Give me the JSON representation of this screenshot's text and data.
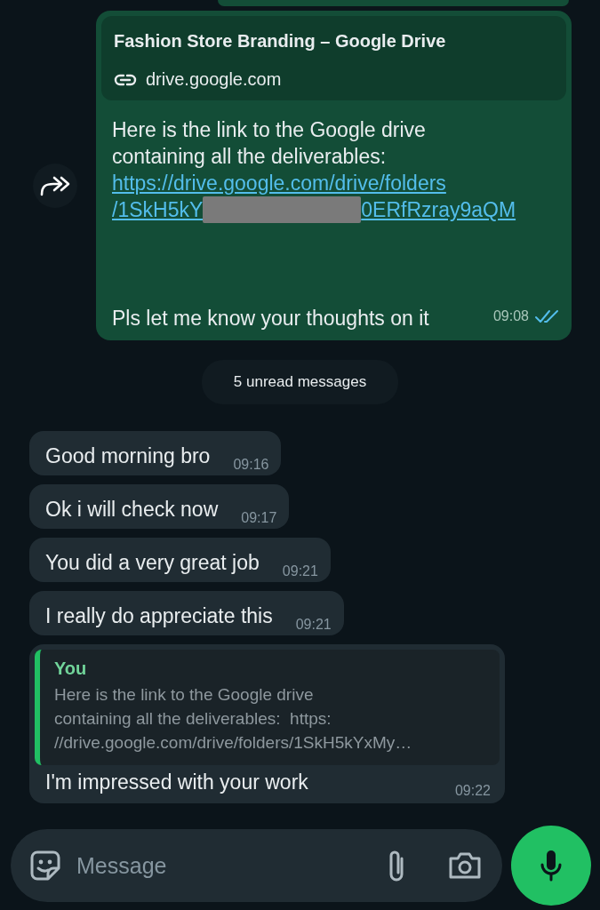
{
  "messages": [
    {
      "kind": "outgoing",
      "preview": {
        "title": "Fashion Store Branding – Google Drive",
        "domain": "drive.google.com"
      },
      "text": "Here is the link to the Google drive containing all the deliverables:",
      "link": {
        "line_1": "https://drive.google.com/drive/folders",
        "line_2_start": "/1SkH5kY",
        "line_2_end": "0ERfRzray9aQM",
        "redacted": true
      },
      "closing": "Pls let me know your thoughts on it",
      "time": "09:08",
      "read": true
    },
    {
      "kind": "divider",
      "label": "5 unread messages"
    },
    {
      "kind": "incoming",
      "text": "Good morning bro",
      "time": "09:16"
    },
    {
      "kind": "incoming",
      "text": "Ok i will check now",
      "time": "09:17"
    },
    {
      "kind": "incoming",
      "text": "You did a very great job",
      "time": "09:21"
    },
    {
      "kind": "incoming",
      "text": "I really do appreciate this",
      "time": "09:21"
    },
    {
      "kind": "reply",
      "quote": {
        "author": "You",
        "lines": [
          "Here is the link to the Google drive",
          "containing all the deliverables:  https:",
          "//drive.google.com/drive/folders/1SkH5kYxMy…"
        ]
      },
      "text": "I'm impressed with your work",
      "time": "09:22"
    }
  ],
  "composer": {
    "placeholder": "Message"
  }
}
